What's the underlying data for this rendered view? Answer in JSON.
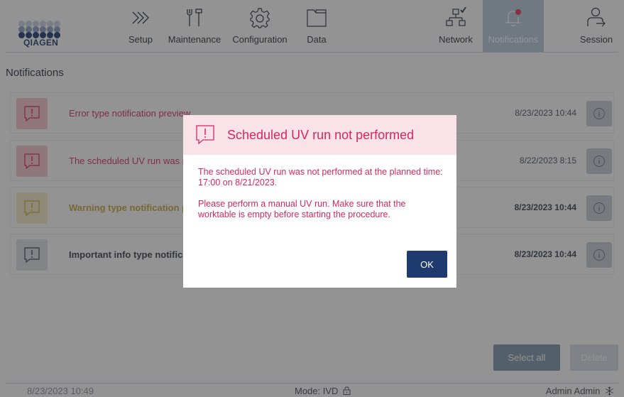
{
  "brand": {
    "logo_text": "QIAGEN"
  },
  "nav": {
    "setup": "Setup",
    "maintenance": "Maintenance",
    "configuration": "Configuration",
    "data": "Data",
    "network": "Network",
    "notifications": "Notifications",
    "session": "Session"
  },
  "page": {
    "title": "Notifications"
  },
  "notifications": [
    {
      "type": "error",
      "text": "Error type notification preview",
      "time": "8/23/2023 10:44"
    },
    {
      "type": "error",
      "text": "The scheduled UV run was not performed",
      "time": "8/22/2023 8:15"
    },
    {
      "type": "warning",
      "text": "Warning type notification preview",
      "time": "8/23/2023 10:44"
    },
    {
      "type": "info",
      "text": "Important info type notification preview",
      "time": "8/23/2023 10:44"
    }
  ],
  "actions": {
    "select_all": "Select all",
    "delete": "Delete"
  },
  "status_bar": {
    "datetime": "8/23/2023 10:49",
    "mode": "Mode: IVD",
    "user": "Admin Admin"
  },
  "modal": {
    "title": "Scheduled UV run not performed",
    "paragraph1": "The scheduled UV run was not performed at the planned time: 17:00 on 8/21/2023.",
    "paragraph2": "Please perform a manual UV run. Make sure that the worktable is empty before starting the procedure.",
    "ok_label": "OK"
  },
  "colors": {
    "brand": "#1e3f74",
    "error": "#d6285e",
    "warning": "#c8a83a",
    "active_nav": "#b9c9dc",
    "primary_button": "#1e3a6e"
  },
  "icons": {
    "setup": "chevrons-right-icon",
    "maintenance": "tools-icon",
    "configuration": "gear-icon",
    "data": "folder-icon",
    "network": "network-icon",
    "notifications": "bell-icon",
    "session": "user-exit-icon",
    "notification": "exclamation-bubble-icon",
    "info": "info-icon",
    "lock": "lock-icon",
    "snowflake": "snowflake-icon"
  }
}
